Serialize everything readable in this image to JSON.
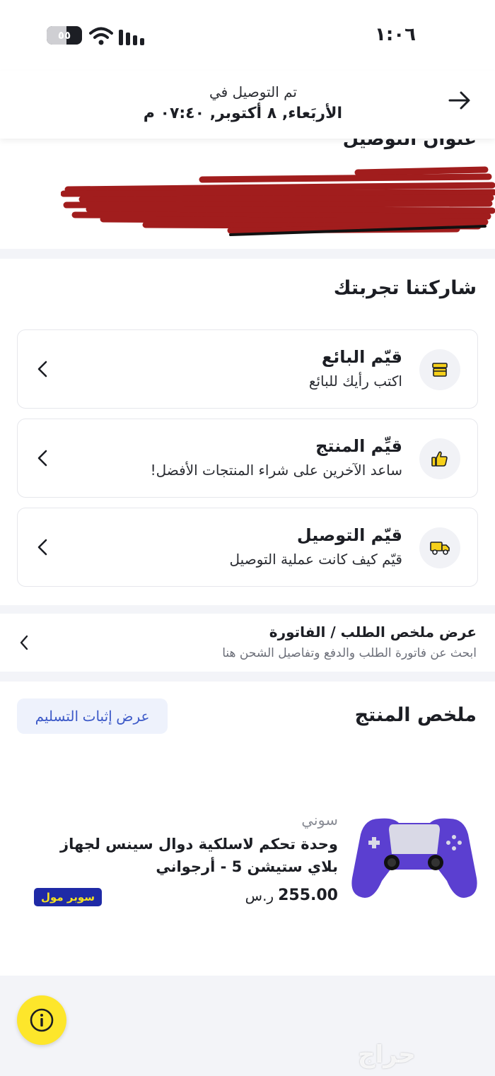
{
  "status_bar": {
    "time": "١:٠٦",
    "battery_level": "٥٥",
    "battery_fraction": 0.55,
    "wifi_icon": "wifi-icon",
    "signal_icon": "cellular-signal-icon"
  },
  "header": {
    "delivered_label": "تم التوصيل في",
    "delivered_date": "الأربَعاء, ٨ أكتوبر, ٠٧:٤٠ م",
    "back_icon": "arrow-right-icon"
  },
  "address": {
    "title": "عنوان التوصيل"
  },
  "experience": {
    "title": "شاركتنا تجربتك",
    "items": [
      {
        "title": "قيّم البائع",
        "subtitle": "اكتب رأيك للبائع",
        "icon": "store-icon"
      },
      {
        "title": "قيِّم المنتج",
        "subtitle": "ساعد الآخرين على شراء المنتجات الأفضل!",
        "icon": "thumbs-up-icon"
      },
      {
        "title": "قيّم التوصيل",
        "subtitle": "قيّم كيف كانت عملية التوصيل",
        "icon": "delivery-truck-icon"
      }
    ]
  },
  "invoice": {
    "title": "عرض ملخص الطلب / الفاتورة",
    "subtitle": "ابحث عن فاتورة الطلب والدفع وتفاصيل الشحن هنا"
  },
  "product_summary": {
    "title": "ملخص المنتج",
    "proof_button": "عرض إثبات التسليم",
    "brand": "سوني",
    "name": "وحدة تحكم لاسلكية دوال سينس لجهاز بلاي ستيشن 5 - أرجواني",
    "price": "255.00",
    "currency": "ر.س",
    "badge": "سوبر مول"
  },
  "help_icon": "info-icon",
  "watermark": "حراج",
  "colors": {
    "accent_yellow": "#fde62b",
    "proof_button_bg": "#eef2fc",
    "proof_button_text": "#3d5ac8",
    "badge_bg": "#1f2aa6",
    "badge_text": "#f6e21f",
    "controller_purple": "#5b3fd0"
  }
}
